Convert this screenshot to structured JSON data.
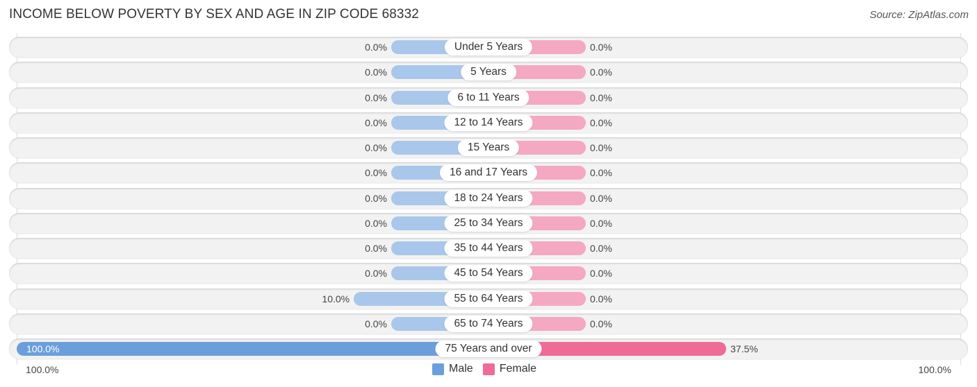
{
  "header": {
    "title": "INCOME BELOW POVERTY BY SEX AND AGE IN ZIP CODE 68332",
    "source": "Source: ZipAtlas.com"
  },
  "colors": {
    "male": "#a9c7ea",
    "male_strong": "#6a9fdb",
    "female": "#f5a8c2",
    "female_strong": "#f06b95"
  },
  "chart_data": {
    "type": "bar",
    "orientation": "horizontal-diverging",
    "title": "INCOME BELOW POVERTY BY SEX AND AGE IN ZIP CODE 68332",
    "categories": [
      "Under 5 Years",
      "5 Years",
      "6 to 11 Years",
      "12 to 14 Years",
      "15 Years",
      "16 and 17 Years",
      "18 to 24 Years",
      "25 to 34 Years",
      "35 to 44 Years",
      "45 to 54 Years",
      "55 to 64 Years",
      "65 to 74 Years",
      "75 Years and over"
    ],
    "series": [
      {
        "name": "Male",
        "values": [
          0.0,
          0.0,
          0.0,
          0.0,
          0.0,
          0.0,
          0.0,
          0.0,
          0.0,
          0.0,
          10.0,
          0.0,
          100.0
        ],
        "labels": [
          "0.0%",
          "0.0%",
          "0.0%",
          "0.0%",
          "0.0%",
          "0.0%",
          "0.0%",
          "0.0%",
          "0.0%",
          "0.0%",
          "10.0%",
          "0.0%",
          "100.0%"
        ]
      },
      {
        "name": "Female",
        "values": [
          0.0,
          0.0,
          0.0,
          0.0,
          0.0,
          0.0,
          0.0,
          0.0,
          0.0,
          0.0,
          0.0,
          0.0,
          37.5
        ],
        "labels": [
          "0.0%",
          "0.0%",
          "0.0%",
          "0.0%",
          "0.0%",
          "0.0%",
          "0.0%",
          "0.0%",
          "0.0%",
          "0.0%",
          "0.0%",
          "0.0%",
          "37.5%"
        ]
      }
    ],
    "xlim": [
      0,
      100
    ],
    "axis_labels": {
      "left": "100.0%",
      "right": "100.0%"
    },
    "legend": {
      "position": "bottom-center",
      "entries": [
        "Male",
        "Female"
      ]
    },
    "unit": "%"
  }
}
